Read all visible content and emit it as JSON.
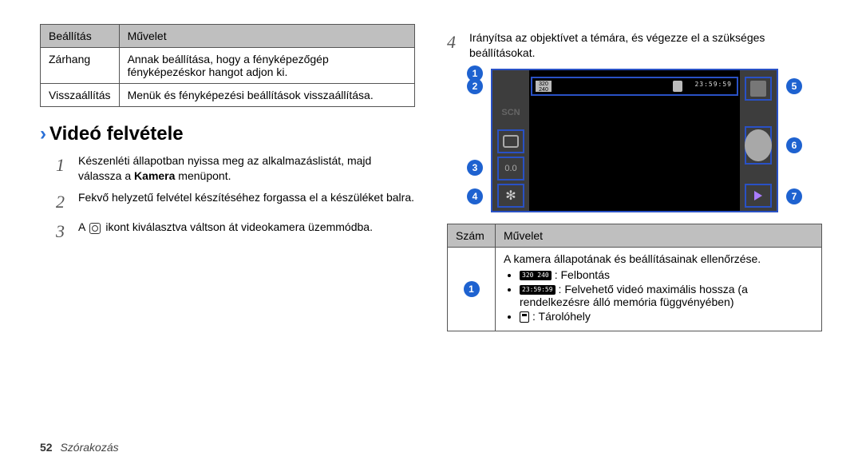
{
  "left_table": {
    "headers": [
      "Beállítás",
      "Művelet"
    ],
    "rows": [
      {
        "setting": "Zárhang",
        "action": "Annak beállítása, hogy a fényképezőgép fényképezéskor hangot adjon ki."
      },
      {
        "setting": "Visszaállítás",
        "action": "Menük és fényképezési beállítások visszaállítása."
      }
    ]
  },
  "section_heading": "Videó felvétele",
  "steps_left": [
    {
      "n": "1",
      "text_before": "Készenléti állapotban nyissa meg az alkalmazáslistát, majd válassza a ",
      "bold": "Kamera",
      "text_after": " menüpont."
    },
    {
      "n": "2",
      "text": "Fekvő helyzetű felvétel készítéséhez forgassa el a készüléket balra."
    },
    {
      "n": "3",
      "text_before": "A ",
      "icon": "camera",
      "text_after": " ikont kiválasztva váltson át videokamera üzemmódba."
    }
  ],
  "step_right": {
    "n": "4",
    "text": "Irányítsa az objektívet a témára, és végezze el a szükséges beállításokat."
  },
  "camcorder": {
    "resolution_label": "320\n240",
    "timer": "23:59:59",
    "scn_label": "SCN",
    "exposure_label": "0.0"
  },
  "callouts": [
    "1",
    "2",
    "3",
    "4",
    "5",
    "6",
    "7"
  ],
  "features_table": {
    "headers": [
      "Szám",
      "Művelet"
    ],
    "row1": {
      "num": "1",
      "intro": "A kamera állapotának és beállításainak ellenőrzése.",
      "bullets": {
        "b1_label": "Felbontás",
        "b1_icon": "320\n240",
        "b2_icon": "23:59:59",
        "b2_label": "Felvehető videó maximális hossza (a rendelkezésre álló memória függvényében)",
        "b3_label": "Tárolóhely"
      }
    }
  },
  "footer": {
    "page": "52",
    "section": "Szórakozás"
  }
}
